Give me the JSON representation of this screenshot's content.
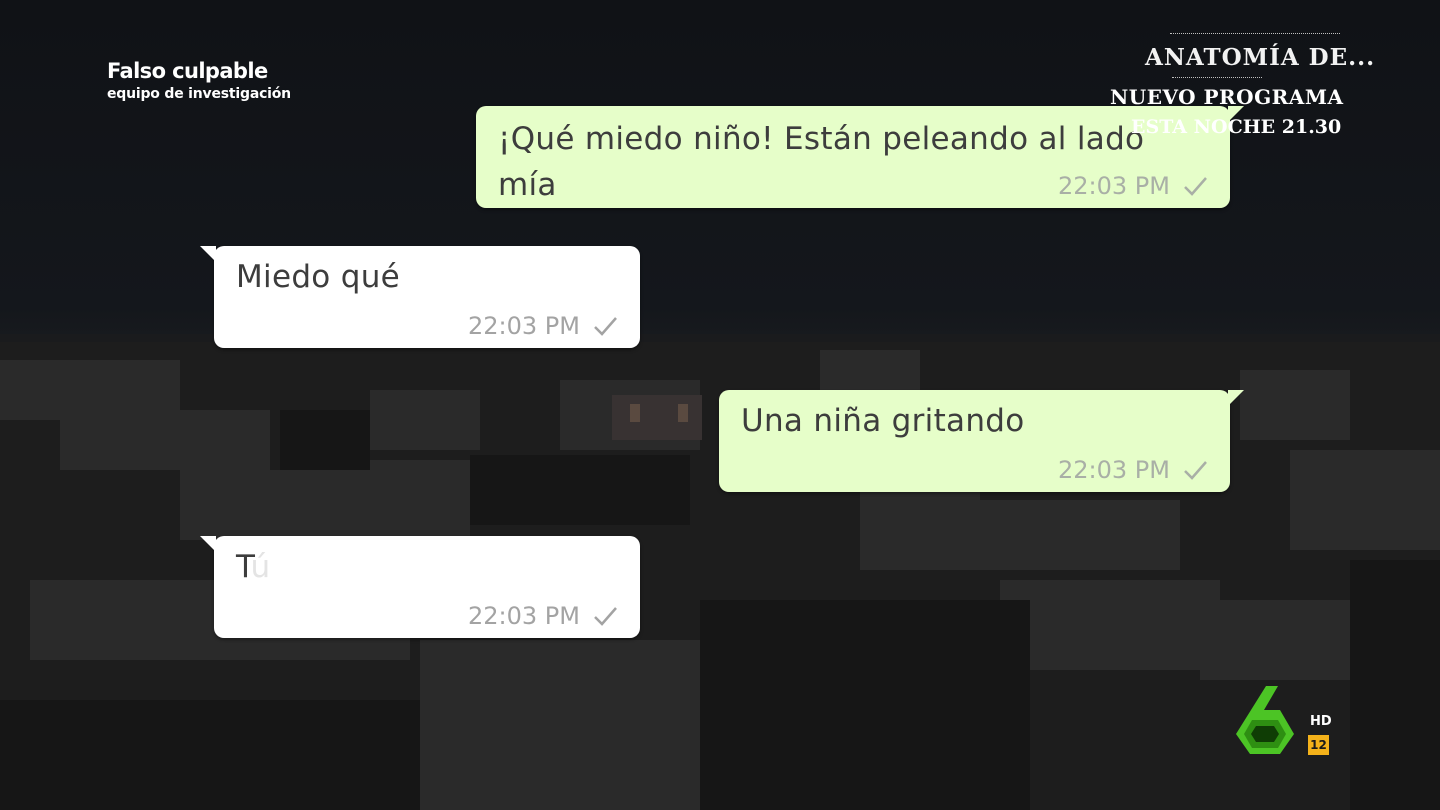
{
  "show": {
    "title": "Falso culpable",
    "subtitle": "equipo de investigación"
  },
  "promo": {
    "line1": "ANATOMÍA DE...",
    "line2": "NUEVO PROGRAMA",
    "line3": "ESTA NOCHE 21.30"
  },
  "messages": [
    {
      "direction": "outgoing",
      "text": "¡Qué miedo niño! Están peleando al lado mía",
      "time": "22:03 PM"
    },
    {
      "direction": "incoming",
      "text": "Miedo qué",
      "time": "22:03 PM"
    },
    {
      "direction": "outgoing",
      "text": "Una niña gritando",
      "time": "22:03 PM"
    },
    {
      "direction": "incoming",
      "text": "T",
      "text_faded": "ú",
      "time": "22:03 PM"
    }
  ],
  "channel": {
    "logo_icon": "la-sexta-logo-icon",
    "quality": "HD",
    "age_rating": "12"
  },
  "colors": {
    "outgoing_bubble": "#e6fec9",
    "incoming_bubble": "#ffffff",
    "logo_green": "#4cc425",
    "rating_badge": "#f4b21a"
  }
}
